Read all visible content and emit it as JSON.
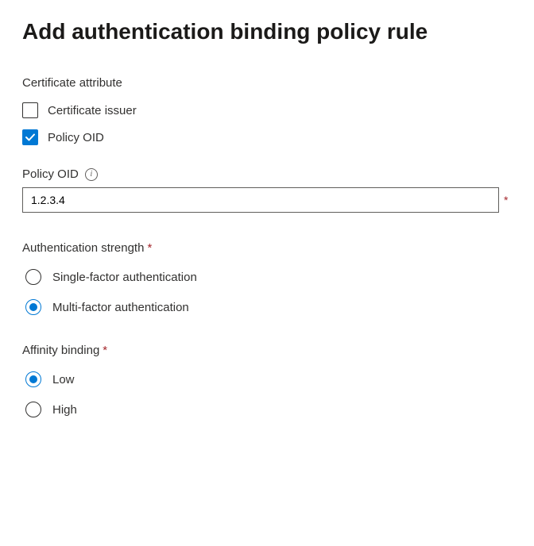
{
  "page_title": "Add authentication binding policy rule",
  "certificate_attribute": {
    "label": "Certificate attribute",
    "options": [
      {
        "label": "Certificate issuer",
        "checked": false
      },
      {
        "label": "Policy OID",
        "checked": true
      }
    ]
  },
  "policy_oid_field": {
    "label": "Policy OID",
    "value": "1.2.3.4",
    "required": true
  },
  "authentication_strength": {
    "label": "Authentication strength",
    "required": true,
    "options": [
      {
        "label": "Single-factor authentication",
        "selected": false
      },
      {
        "label": "Multi-factor authentication",
        "selected": true
      }
    ]
  },
  "affinity_binding": {
    "label": "Affinity binding",
    "required": true,
    "options": [
      {
        "label": "Low",
        "selected": true
      },
      {
        "label": "High",
        "selected": false
      }
    ]
  }
}
